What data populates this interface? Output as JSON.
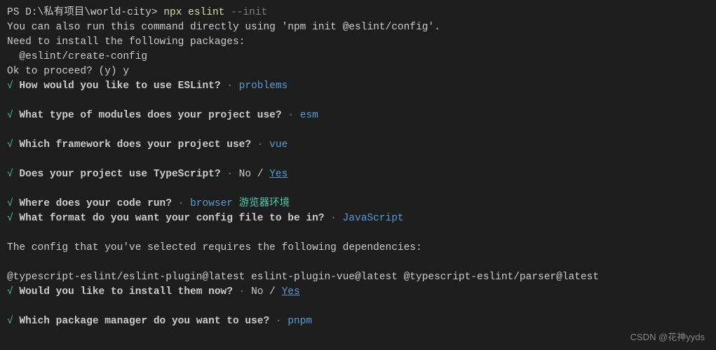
{
  "prompt": {
    "prefix": "PS ",
    "path": "D:\\私有项目\\world-city",
    "suffix": "> ",
    "cmd1": "npx",
    "cmd2": " eslint",
    "flag": " --init"
  },
  "info": {
    "line1": "You can also run this command directly using 'npm init @eslint/config'.",
    "line2": "Need to install the following packages:",
    "line3": "  @eslint/create-config",
    "line4_a": "Ok to proceed? (y) ",
    "line4_b": "y"
  },
  "checkmark": "√",
  "sep": " · ",
  "q1": {
    "text": " How would you like to use ESLint?",
    "answer": "problems"
  },
  "q2": {
    "text": " What type of modules does your project use?",
    "answer": "esm"
  },
  "q3": {
    "text": " Which framework does your project use?",
    "answer": "vue"
  },
  "q4": {
    "text": " Does your project use TypeScript?",
    "no": "No",
    "slash": " / ",
    "yes": "Yes"
  },
  "q5": {
    "text": " Where does your code run?",
    "answer": "browser",
    "annotation": " 游览器环境"
  },
  "q6": {
    "text": " What format do you want your config file to be in?",
    "answer": "JavaScript"
  },
  "deps": {
    "intro": "The config that you've selected requires the following dependencies:",
    "list": "@typescript-eslint/eslint-plugin@latest eslint-plugin-vue@latest @typescript-eslint/parser@latest"
  },
  "q7": {
    "text": " Would you like to install them now?",
    "no": "No",
    "slash": " / ",
    "yes": "Yes"
  },
  "q8": {
    "text": " Which package manager do you want to use?",
    "answer": "pnpm"
  },
  "watermark": "CSDN @花神yyds"
}
